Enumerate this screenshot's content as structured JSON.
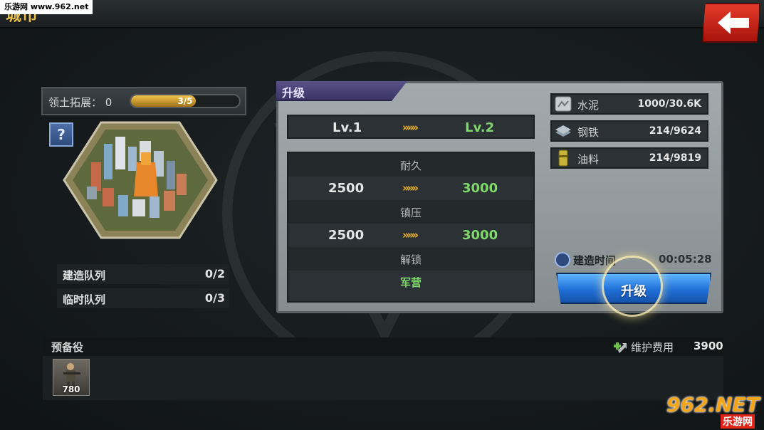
{
  "header": {
    "title": "城市",
    "watermark": "乐游网 www.962.net",
    "back_icon": "back-arrow-icon"
  },
  "territory": {
    "label": "领土拓展：",
    "value": "0",
    "progress_text": "3/5",
    "progress_fraction": 0.6
  },
  "help_label": "?",
  "queues": [
    {
      "label": "建造队列",
      "value": "0/2"
    },
    {
      "label": "临时队列",
      "value": "0/3"
    }
  ],
  "upgrade_panel": {
    "tab_label": "升级",
    "level_current": "Lv.1",
    "level_next": "Lv.2",
    "arrows": "»»»",
    "stats": [
      {
        "name": "耐久",
        "current": "2500",
        "next": "3000"
      },
      {
        "name": "镇压",
        "current": "2500",
        "next": "3000"
      },
      {
        "name": "解锁",
        "unlock": "军营"
      }
    ],
    "resources": [
      {
        "label": "水泥",
        "value": "1000/30.6K",
        "icon": "cement-icon",
        "color": "#c9ced3"
      },
      {
        "label": "钢铁",
        "value": "214/9624",
        "icon": "steel-icon",
        "color": "#8fa0ab"
      },
      {
        "label": "油料",
        "value": "214/9819",
        "icon": "oil-icon",
        "color": "#c7b33a"
      }
    ],
    "build_time_label": "建造时间",
    "build_time_value": "00:05:28",
    "upgrade_button_label": "升级"
  },
  "reserve": {
    "label": "预备役",
    "maintenance_label": "维护费用",
    "maintenance_value": "3900",
    "units": [
      {
        "count": "780"
      }
    ]
  },
  "logo": {
    "main": "962.NET",
    "sub": "乐游网"
  },
  "colors": {
    "accent_gold": "#f2b628",
    "upgrade_green": "#7fd86a",
    "button_blue": "#1f6fd8",
    "back_red": "#e33a2a"
  }
}
